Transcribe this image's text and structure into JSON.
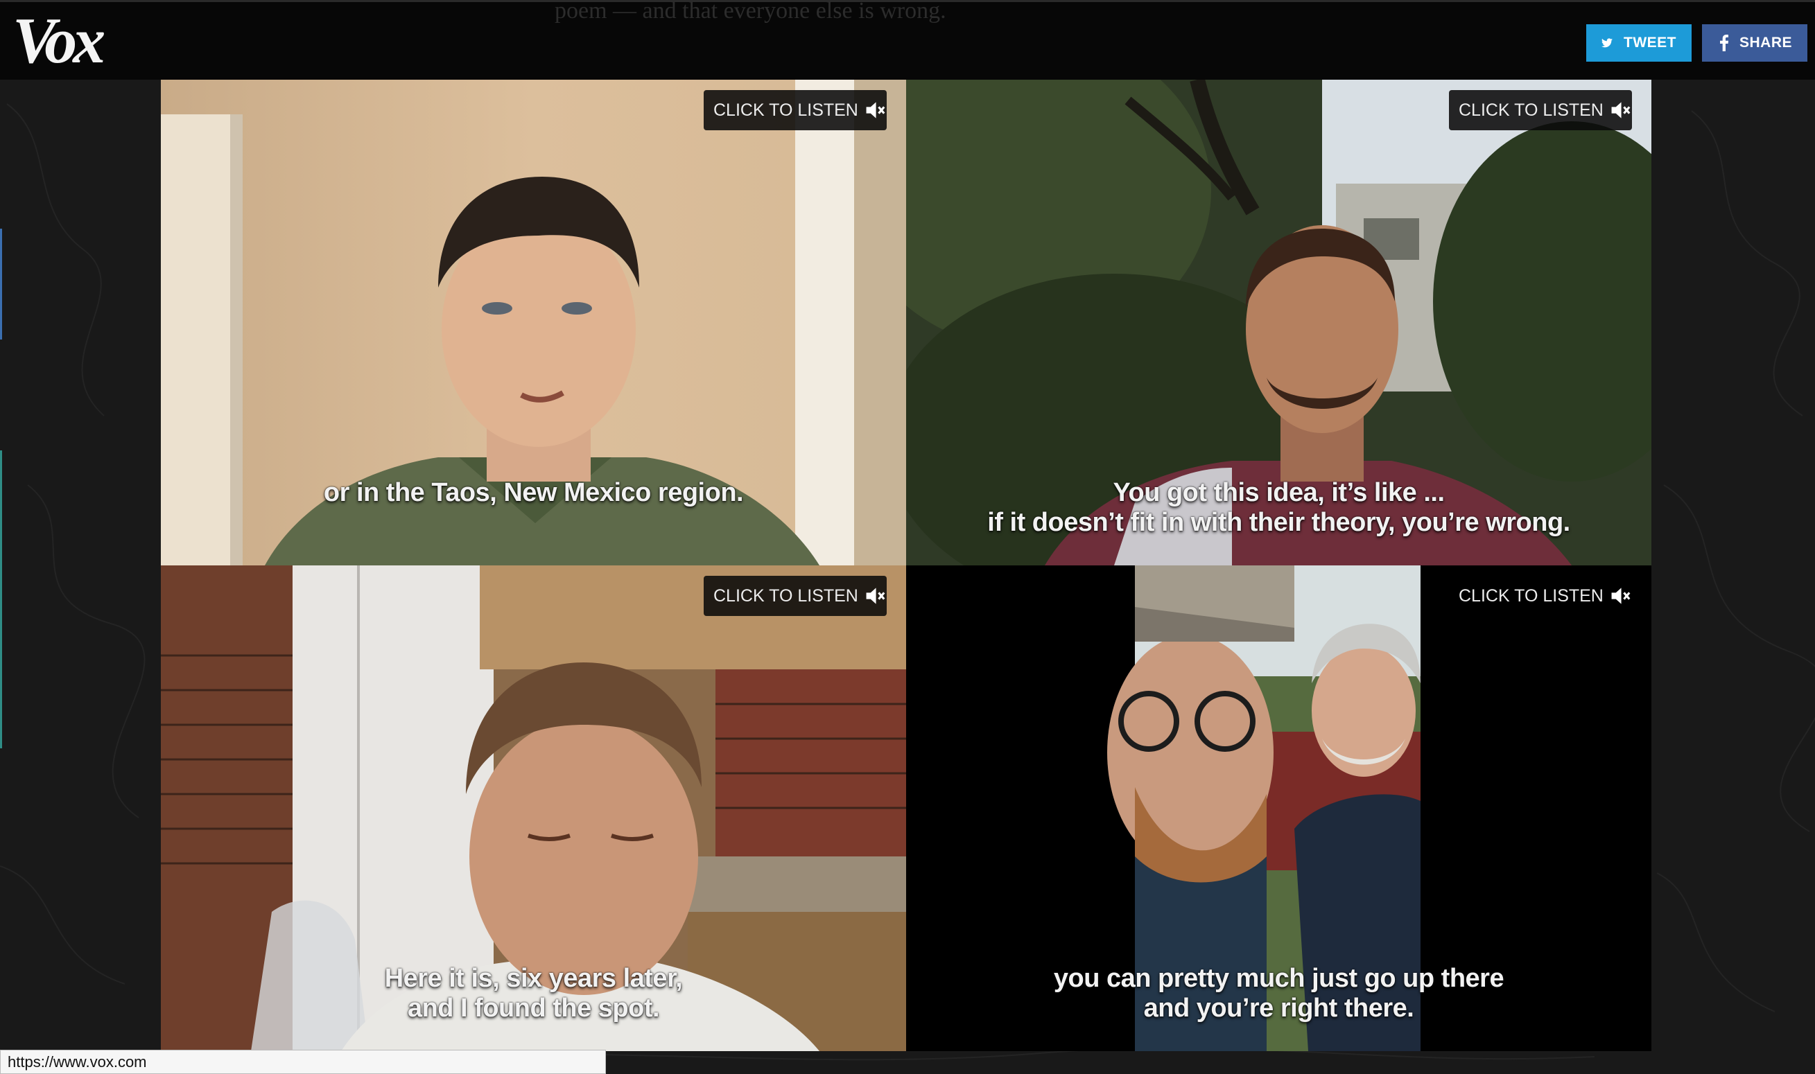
{
  "header": {
    "background_text": "poem — and that everyone else is wrong.",
    "logo": "Vox",
    "tweet_label": "TWEET",
    "share_label": "SHARE",
    "tweet_color": "#1d9bd8",
    "share_color": "#3b5b99"
  },
  "videos": [
    {
      "listen_label": "CLICK TO LISTEN",
      "icon": "speaker-muted-icon",
      "caption_lines": [
        "or in the Taos, New Mexico region."
      ]
    },
    {
      "listen_label": "CLICK TO LISTEN",
      "icon": "speaker-muted-icon",
      "caption_lines": [
        "You got this idea, it’s like ...",
        "if it doesn’t fit in with their theory, you’re wrong."
      ]
    },
    {
      "listen_label": "CLICK TO LISTEN",
      "icon": "speaker-muted-icon",
      "caption_lines": [
        "Here it is, six years later,",
        "and I found the spot."
      ]
    },
    {
      "listen_label": "CLICK TO LISTEN",
      "icon": "speaker-muted-icon",
      "caption_lines": [
        "you can pretty much just go up there",
        "and you’re right there."
      ]
    }
  ],
  "status_bar": {
    "url": "https://www.vox.com"
  }
}
